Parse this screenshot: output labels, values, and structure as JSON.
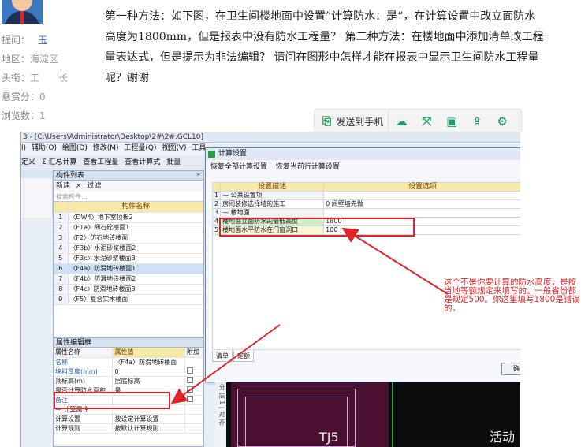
{
  "user": {
    "asker_label": "提问：",
    "asker_name": "玉",
    "region_label": "地区：",
    "region_value": "海淀区",
    "rank_label": "头衔：",
    "rank_value": "工　　长",
    "bounty_label": "悬赏分：",
    "bounty_value": "0",
    "views_label": "浏览数：",
    "views_value": "1"
  },
  "question": {
    "text": "第一种方法：如下图，在卫生间楼地面中设置”计算防水：是“，在计算设置中改立面防水高度为1800mm，但是报表中没有防水工程量？ 第二种方法：在楼地面中添加清单改工程量表达式，但是提示为非法编辑？ 请问在图形中怎样才能在报表中显示卫生间防水工程量呢？谢谢"
  },
  "share_bar": {
    "send_to_phone": "发送到手机",
    "icons": [
      "cloud-icon",
      "expand-icon",
      "save-icon",
      "share-icon",
      "gear-icon"
    ]
  },
  "screenshot": {
    "window_title": "3 - [C:\\Users\\Administrator\\Desktop\\2#\\2#.GCL10]",
    "menu": [
      "l)",
      "辅助(O)",
      "绘图(D)",
      "修改(M)",
      "工程量(Q)",
      "视图(V)",
      "工具(T)"
    ],
    "toolbar": [
      "定义",
      "Σ 汇总计算",
      "查看工程量",
      "查看计算式",
      "批量"
    ],
    "component_panel": {
      "title": "构件列表",
      "tools": [
        "新建",
        "×",
        "过滤"
      ],
      "search_placeholder": "搜索构件...",
      "header": "构件名称",
      "rows": [
        {
          "num": "1",
          "name": "〈DW4〉地下室顶板2"
        },
        {
          "num": "2",
          "name": "〈F1a〉细石砼楼面1"
        },
        {
          "num": "3",
          "name": "〈F2〉仿石地砖楼面"
        },
        {
          "num": "4",
          "name": "〈F3b〉水泥砂浆楼面2"
        },
        {
          "num": "5",
          "name": "〈F3c〉水泥砂浆楼面3"
        },
        {
          "num": "6",
          "name": "〈F4a〉防滑地砖楼面1"
        },
        {
          "num": "7",
          "name": "〈F4b〉防滑地砖楼面2"
        },
        {
          "num": "8",
          "name": "〈F4c〉防滑地砖楼面3"
        },
        {
          "num": "9",
          "name": "〈F5〉复合实木楼面"
        }
      ]
    },
    "attr_panel": {
      "title": "属性编辑框",
      "col_name": "属性名称",
      "col_value": "属性值",
      "col_extra": "附加",
      "rows": [
        {
          "num": "1",
          "name": "名称",
          "value": "〈F4a〉防滑地砖楼面"
        },
        {
          "num": "2",
          "name": "块料厚度(mm)",
          "value": "0"
        },
        {
          "num": "3",
          "name": "顶标高(m)",
          "value": "层底标高"
        },
        {
          "num": "4",
          "name": "是否计算防水面积",
          "value": "是"
        },
        {
          "num": "5",
          "name": "备注",
          "value": ""
        },
        {
          "num": "6",
          "name": "— 计算属性",
          "value": ""
        },
        {
          "num": "7",
          "name": "计算设置",
          "value": "按设定计算设置"
        },
        {
          "num": "8",
          "name": "计算规则",
          "value": "按默认计算规则"
        }
      ]
    },
    "dialog": {
      "title": "计算设置",
      "tools": [
        "恢复全部计算设置",
        "恢复当前行计算设置"
      ],
      "col_desc": "设置描述",
      "col_option": "设置选项",
      "rows": [
        {
          "num": "1",
          "desc": "— 公共设置项",
          "value": ""
        },
        {
          "num": "2",
          "desc": "房间装修选择墙的施工",
          "value": "0 间壁墙先做"
        },
        {
          "num": "3",
          "desc": "— 楼地面",
          "value": ""
        },
        {
          "num": "4",
          "desc": "楼地面立面防水的最低高度",
          "value": "1800"
        },
        {
          "num": "5",
          "desc": "楼地面水平防水在门窗洞口",
          "value": "100"
        }
      ],
      "tabs": [
        "清单",
        "定额"
      ],
      "ok_label": "确"
    },
    "side_strip_text": "分 层 1 | 对 齐",
    "cad_labels": [
      "TJ5",
      "活动"
    ]
  },
  "annotation": {
    "note": "这个不是你要计算的防水高度，是按当地等额规定来填写的。一般省份都是规定500。你这里填写1800是错误的。"
  },
  "colors": {
    "annotation_red": "#e0262a",
    "link_blue": "#2b64c5",
    "brand_green": "#1aa260"
  }
}
